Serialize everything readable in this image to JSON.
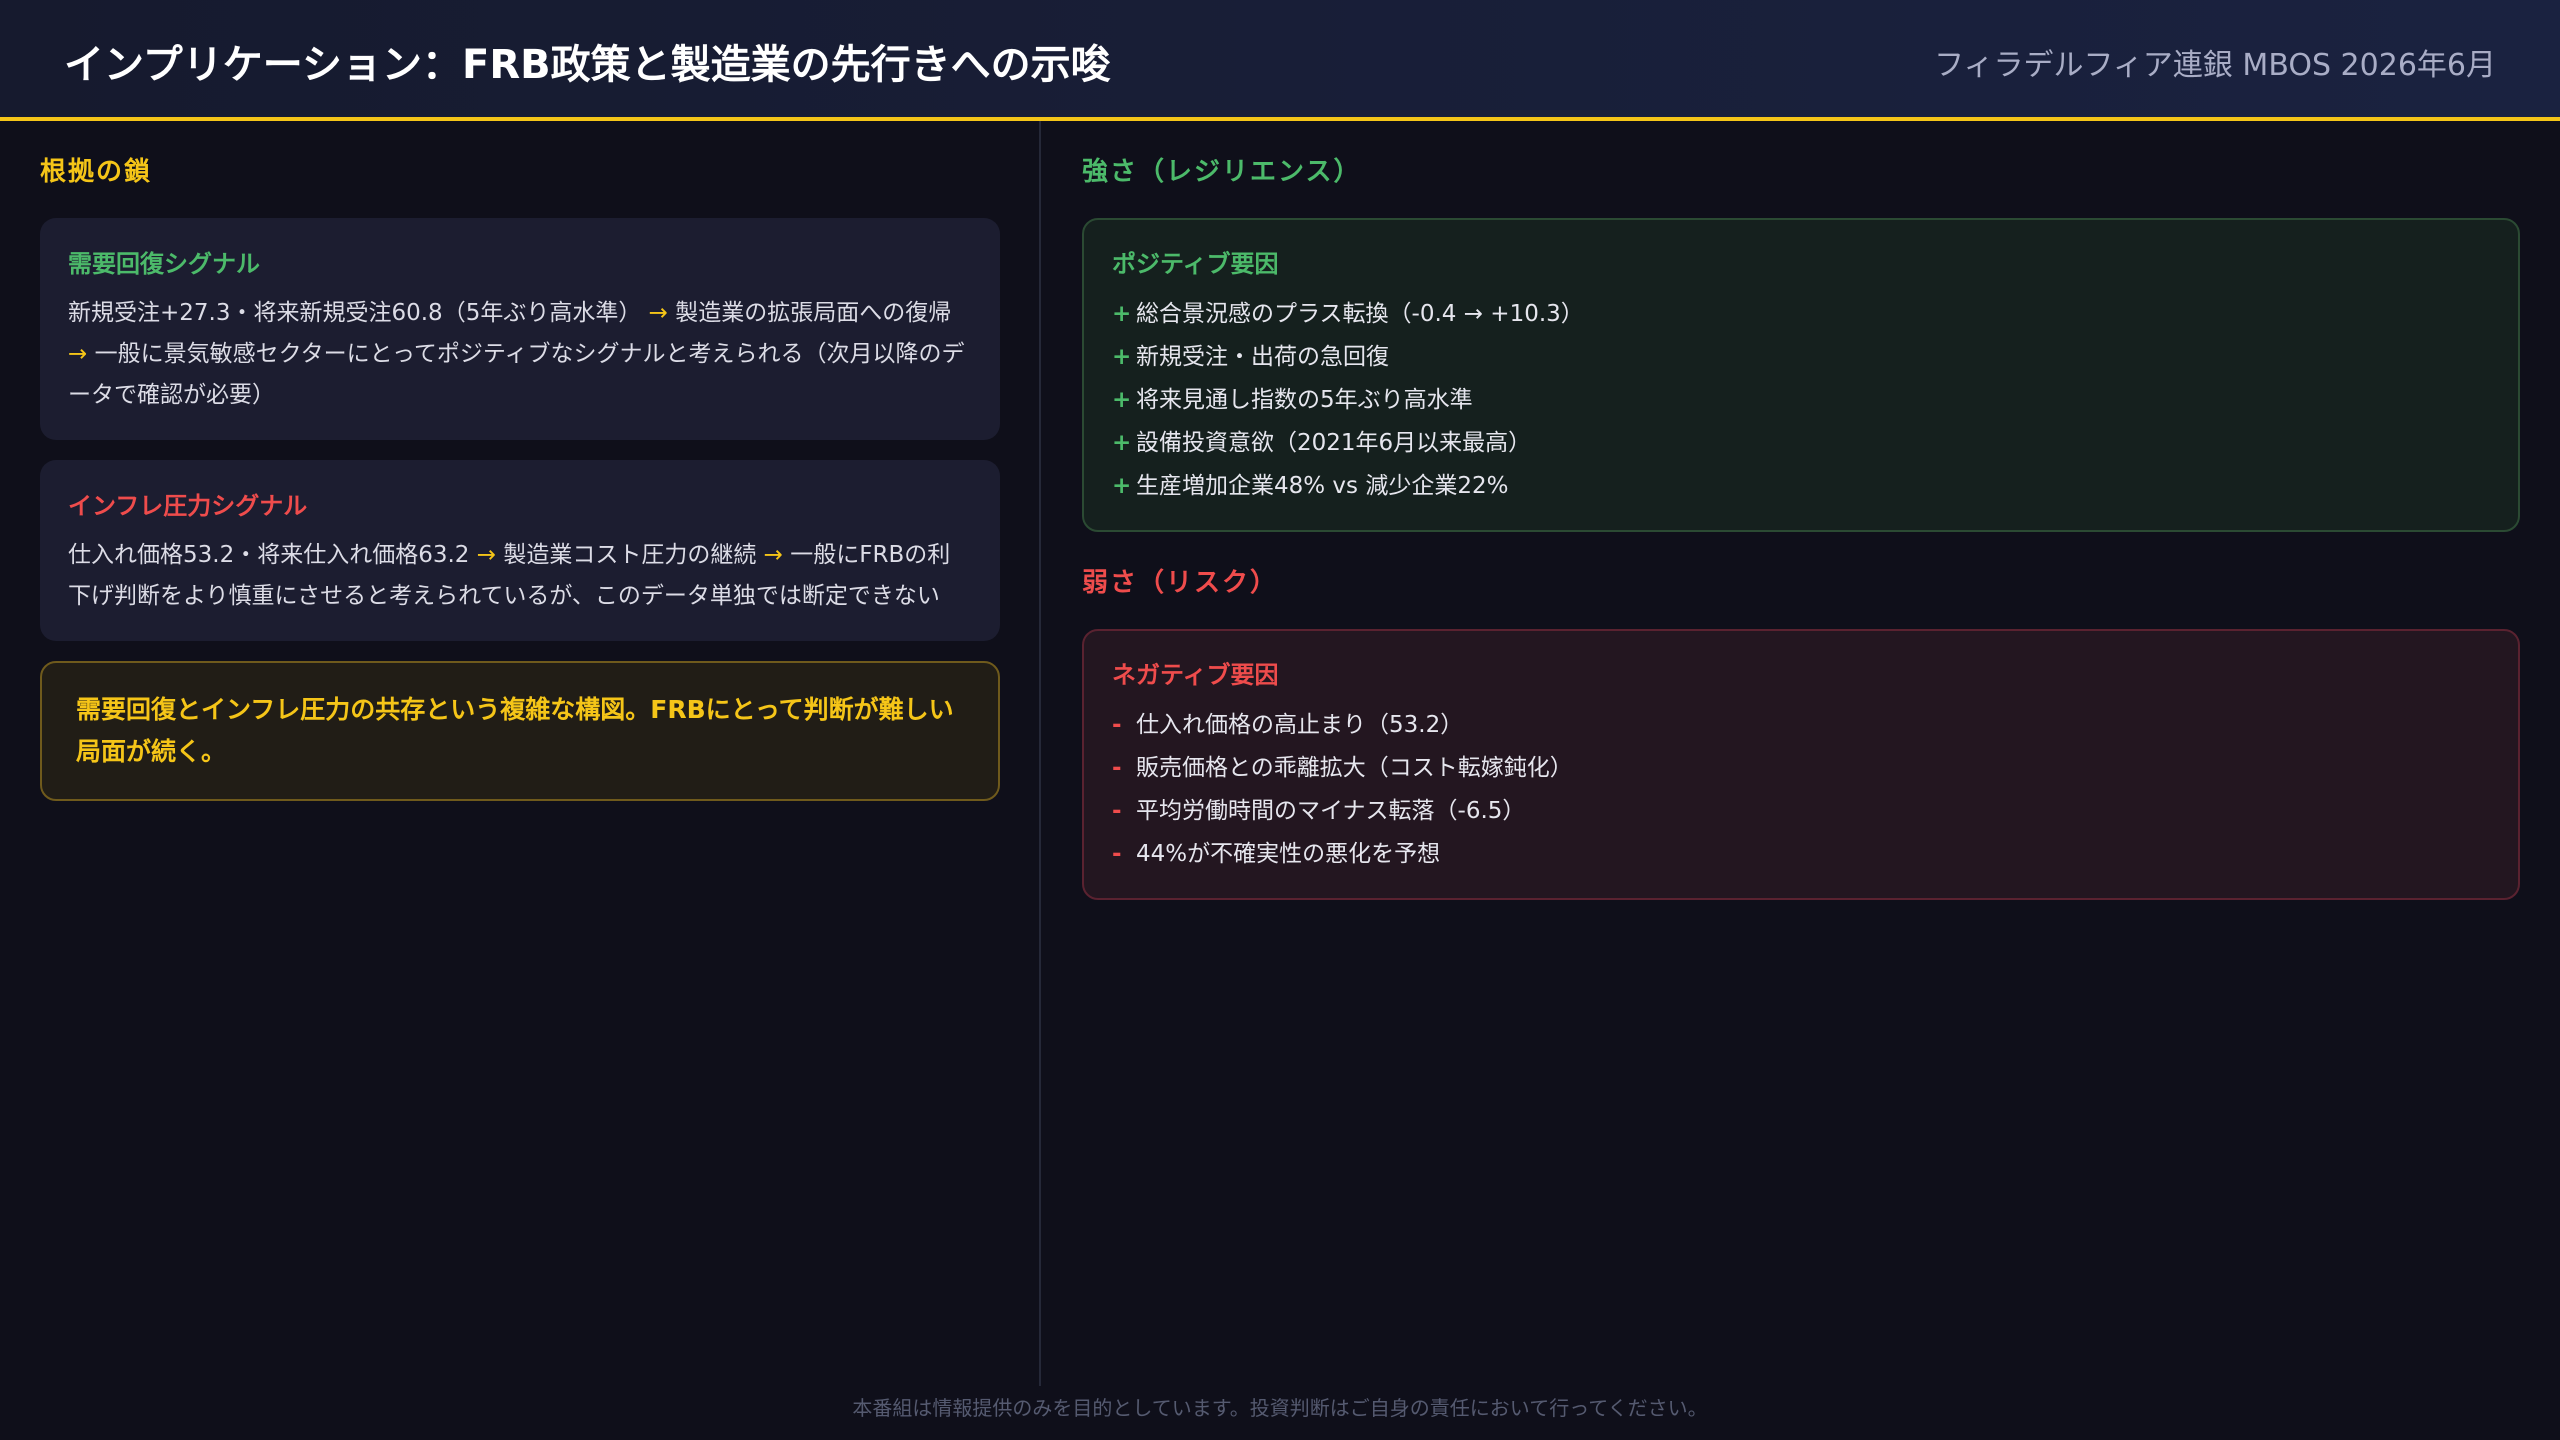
{
  "header": {
    "title": "インプリケーション：FRB政策と製造業の先行きへの示唆",
    "source": "フィラデルフィア連銀 MBOS 2026年6月"
  },
  "left": {
    "section_title": "根拠の鎖",
    "cards": [
      {
        "title": "需要回復シグナル",
        "parts": [
          "新規受注+27.3・将来新規受注60.8（5年ぶり高水準）",
          "製造業の拡張局面への復帰",
          "一般に景気敏感セクターにとってポジティブなシグナルと考えられる（次月以降のデータで確認が必要）"
        ],
        "arrow": "→"
      },
      {
        "title": "インフレ圧力シグナル",
        "parts": [
          "仕入れ価格53.2・将来仕入れ価格63.2",
          "製造業コスト圧力の継続",
          "一般にFRBの利下げ判断をより慎重にさせると考えられているが、このデータ単独では断定できない"
        ],
        "arrow": "→"
      }
    ],
    "conclusion": "需要回復とインフレ圧力の共存という複雑な構図。FRBにとって判断が難しい局面が続く。"
  },
  "right": {
    "strength": {
      "section_title": "強さ（レジリエンス）",
      "card_title": "ポジティブ要因",
      "mark": "+",
      "items": [
        "総合景況感のプラス転換（-0.4 → +10.3）",
        "新規受注・出荷の急回復",
        "将来見通し指数の5年ぶり高水準",
        "設備投資意欲（2021年6月以来最高）",
        "生産増加企業48% vs 減少企業22%"
      ]
    },
    "weakness": {
      "section_title": "弱さ（リスク）",
      "card_title": "ネガティブ要因",
      "mark": "-",
      "items": [
        "仕入れ価格の高止まり（53.2）",
        "販売価格との乖離拡大（コスト転嫁鈍化）",
        "平均労働時間のマイナス転落（-6.5）",
        "44%が不確実性の悪化を予想"
      ]
    }
  },
  "footer": "本番組は情報提供のみを目的としています。投資判断はご自身の責任において行ってください。",
  "colors": {
    "accent": "#f5c518",
    "positive": "#4cba6a",
    "negative": "#ef4c4c",
    "background": "#0f0f1a"
  }
}
